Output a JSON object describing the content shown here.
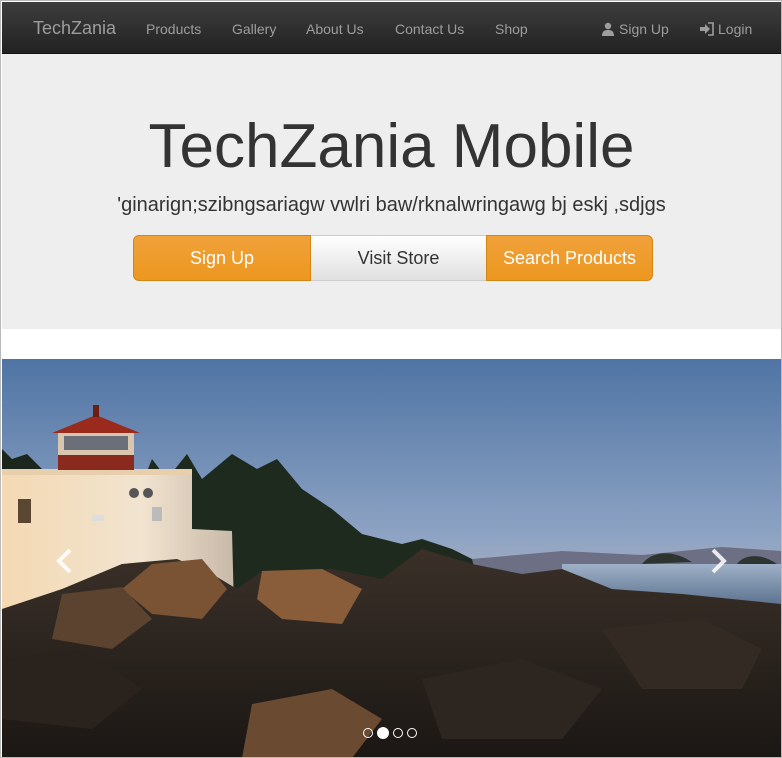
{
  "navbar": {
    "brand": "TechZania",
    "links": [
      "Products",
      "Gallery",
      "About Us",
      "Contact Us",
      "Shop"
    ],
    "signup": {
      "label": "Sign Up",
      "icon": "user-icon"
    },
    "login": {
      "label": "Login",
      "icon": "login-icon"
    }
  },
  "jumbotron": {
    "title": "TechZania Mobile",
    "subtitle": "'ginarign;szibngsariagw vwlri baw/rknalwringawg bj eskj ,sdjgs",
    "buttons": [
      "Sign Up",
      "Visit Store",
      "Search Products"
    ]
  },
  "carousel": {
    "slide_count": 4,
    "active_slide": 2,
    "prev_icon": "chevron-left-icon",
    "next_icon": "chevron-right-icon"
  },
  "colors": {
    "navbar": "#222222",
    "nav_text": "#9d9d9d",
    "jumbotron_bg": "#eeeeee",
    "accent_orange": "#ec971f"
  }
}
